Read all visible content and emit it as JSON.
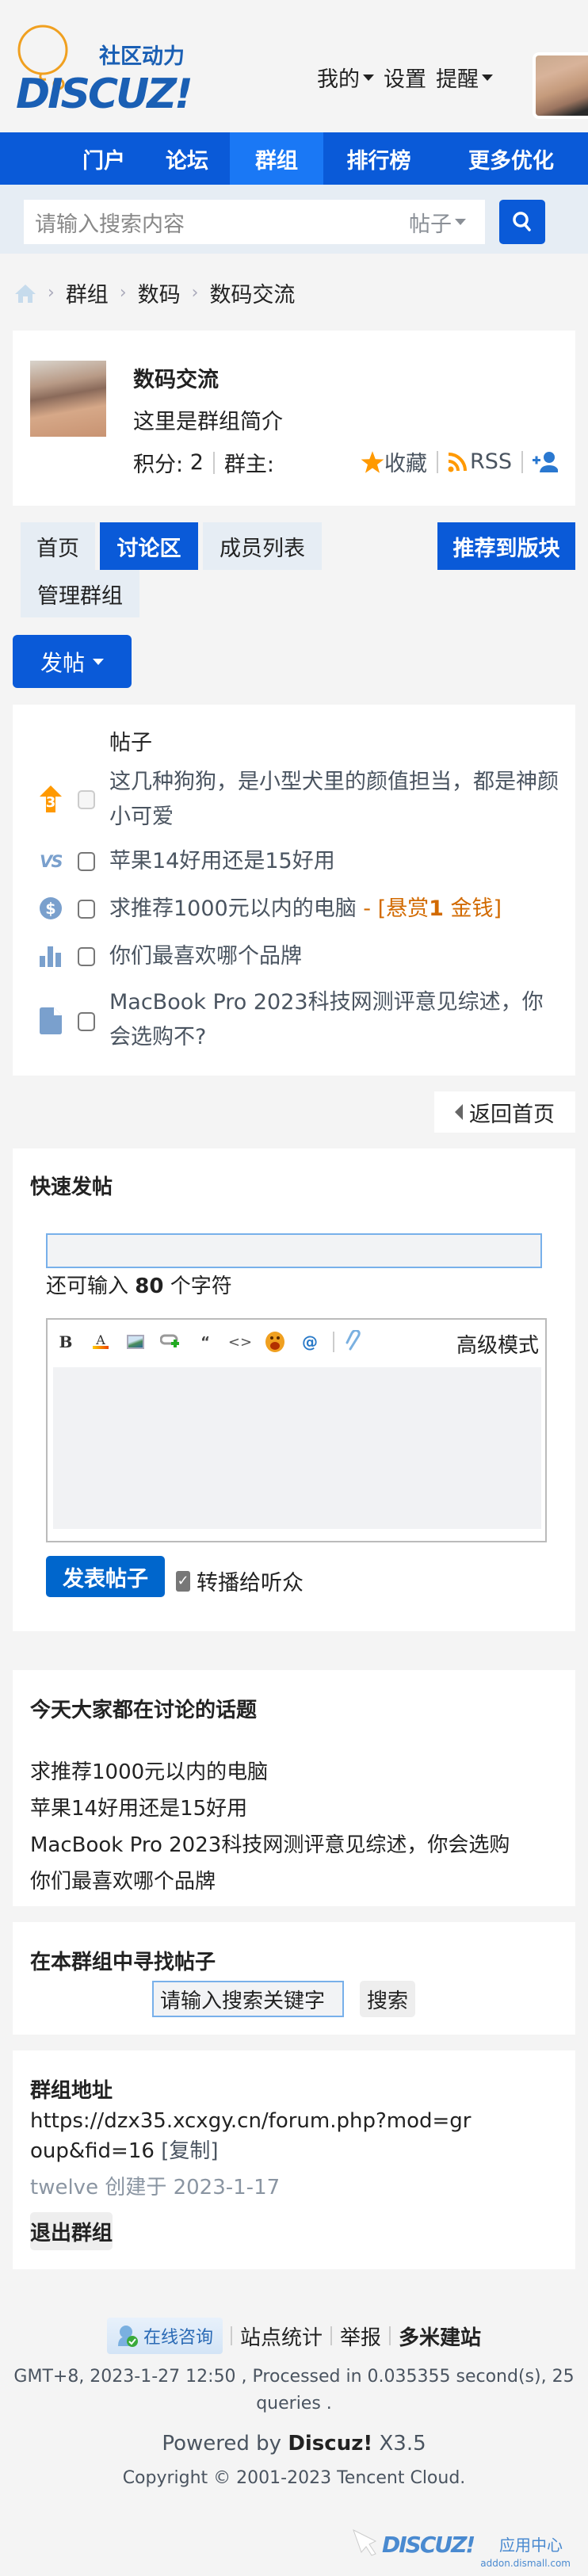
{
  "header": {
    "logo_cn": "社区动力",
    "logo_en": "DISCUZ!",
    "menu": [
      {
        "label": "我的",
        "has_dropdown": true
      },
      {
        "label": "设置",
        "has_dropdown": false
      },
      {
        "label": "提醒",
        "has_dropdown": true
      }
    ]
  },
  "nav": {
    "items": [
      {
        "label": "门户",
        "active": false
      },
      {
        "label": "论坛",
        "active": false
      },
      {
        "label": "群组",
        "active": true
      },
      {
        "label": "排行榜",
        "active": false
      },
      {
        "label": "更多优化",
        "active": false
      }
    ]
  },
  "search": {
    "placeholder": "请输入搜索内容",
    "type": "帖子"
  },
  "breadcrumb": [
    "群组",
    "数码",
    "数码交流"
  ],
  "group": {
    "name": "数码交流",
    "description": "这里是群组简介",
    "points_label": "积分:",
    "points": "2",
    "owner_label": "群主:",
    "owner": "",
    "favorite_label": "收藏",
    "rss_label": "RSS"
  },
  "tabs": [
    {
      "label": "首页",
      "active": false
    },
    {
      "label": "讨论区",
      "active": true
    },
    {
      "label": "成员列表",
      "active": false
    },
    {
      "label": "管理群组",
      "active": false
    }
  ],
  "recommend_label": "推荐到版块",
  "post_button_label": "发帖",
  "post_list": {
    "header": "帖子",
    "posts": [
      {
        "icon": "top-3-icon",
        "title": "这几种狗狗，是小型犬里的颜值担当，都是神颜小可爱",
        "reward": "",
        "checkbox_disabled": true
      },
      {
        "icon": "debate-vs-icon",
        "title": "苹果14好用还是15好用",
        "reward": "",
        "checkbox_disabled": false
      },
      {
        "icon": "reward-dollar-icon",
        "title": "求推荐1000元以内的电脑",
        "reward_prefix": " - [悬赏",
        "reward_amount": "1",
        "reward_suffix": " 金钱]",
        "checkbox_disabled": false
      },
      {
        "icon": "poll-icon",
        "title": "你们最喜欢哪个品牌",
        "reward": "",
        "checkbox_disabled": false
      },
      {
        "icon": "document-icon",
        "title": "MacBook Pro 2023科技网测评意见综述，你会选购不?",
        "reward": "",
        "checkbox_disabled": false
      }
    ]
  },
  "back_home_label": "返回首页",
  "quick_post": {
    "title": "快速发帖",
    "subject_value": "",
    "char_count_prefix": "还可输入",
    "char_count": "80",
    "char_count_suffix": "个字符",
    "toolbar": [
      "bold",
      "font-color",
      "image",
      "link",
      "quote",
      "code",
      "smiley",
      "at",
      "attachment"
    ],
    "advanced_mode_label": "高级模式",
    "submit_label": "发表帖子",
    "broadcast_label": "转播给听众",
    "broadcast_checked": true
  },
  "topics": {
    "title": "今天大家都在讨论的话题",
    "items": [
      "求推荐1000元以内的电脑",
      "苹果14好用还是15好用",
      "MacBook Pro 2023科技网测评意见综述，你会选购",
      "你们最喜欢哪个品牌"
    ]
  },
  "group_search": {
    "title": "在本群组中寻找帖子",
    "placeholder": "请输入搜索关键字",
    "button": "搜索"
  },
  "group_address": {
    "title": "群组地址",
    "url": "https://dzx35.xcxgy.cn/forum.php?mod=group&fid=16",
    "copy_label": "[复制]",
    "creator_line": "twelve 创建于 2023-1-17",
    "quit_label": "退出群组"
  },
  "footer": {
    "online_label": "在线咨询",
    "links": [
      "站点统计",
      "举报",
      "多米建站"
    ],
    "stats_line1": "GMT+8, 2023-1-27 12:50 , Processed in 0.035355 second(s), 25",
    "stats_line2": "queries .",
    "powered_prefix": "Powered by",
    "powered_brand": "Discuz!",
    "powered_version": "X3.5",
    "copyright": "Copyright © 2001-2023 Tencent Cloud.",
    "addon_brand": "DISCUZ!",
    "addon_cn": "应用中心",
    "addon_url": "addon.dismall.com"
  },
  "colors": {
    "primary": "#0a5ad8",
    "nav_active": "#1a78f5",
    "reward": "#d26a00",
    "icon_blue": "#7aa0cd",
    "orange": "#ff9900"
  }
}
